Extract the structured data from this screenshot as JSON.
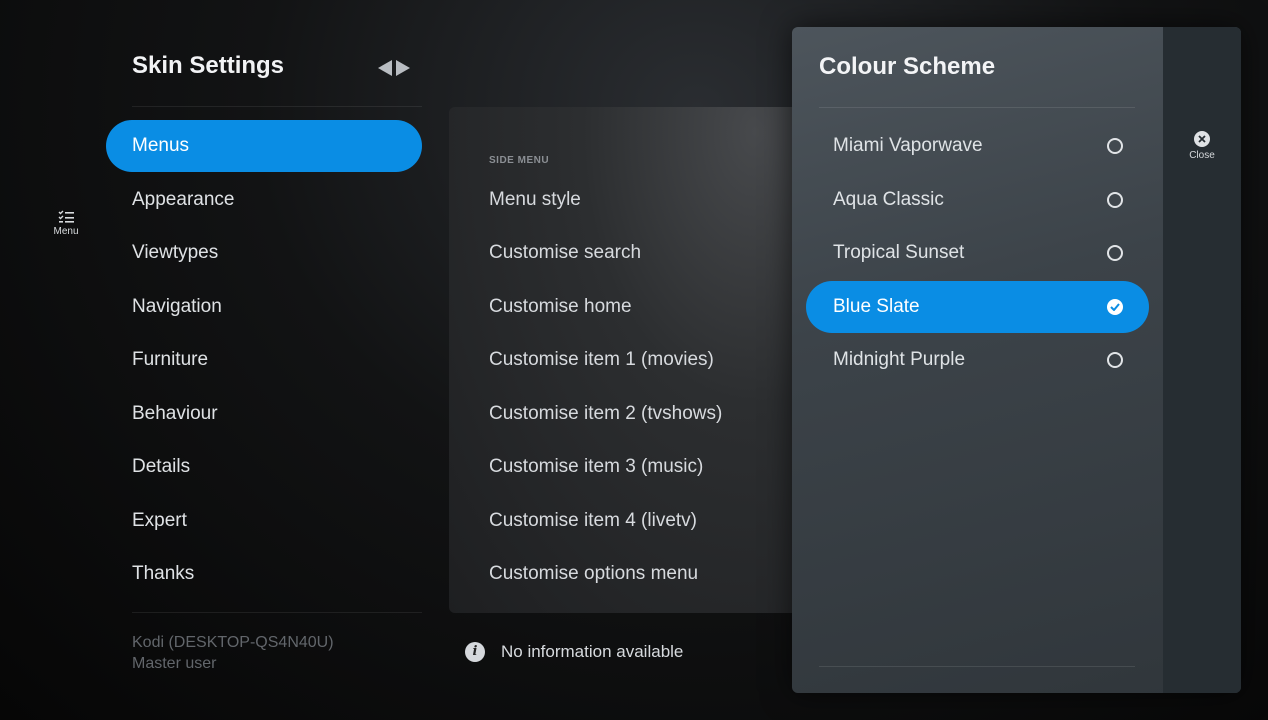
{
  "rail": {
    "menu_label": "Menu",
    "menu_icon": "checklist-icon"
  },
  "sidebar": {
    "title": "Skin Settings",
    "items": [
      {
        "label": "Menus",
        "active": true
      },
      {
        "label": "Appearance"
      },
      {
        "label": "Viewtypes"
      },
      {
        "label": "Navigation"
      },
      {
        "label": "Furniture"
      },
      {
        "label": "Behaviour"
      },
      {
        "label": "Details"
      },
      {
        "label": "Expert"
      },
      {
        "label": "Thanks"
      }
    ],
    "footer": {
      "line1": "Kodi (DESKTOP-QS4N40U)",
      "line2": "Master user"
    }
  },
  "panel": {
    "section_header": "SIDE MENU",
    "items": [
      "Menu style",
      "Customise search",
      "Customise home",
      "Customise item 1 (movies)",
      "Customise item 2 (tvshows)",
      "Customise item 3 (music)",
      "Customise item 4 (livetv)",
      "Customise options menu"
    ]
  },
  "info": {
    "icon": "info-icon",
    "text": "No information available"
  },
  "dialog": {
    "title": "Colour Scheme",
    "options": [
      {
        "label": "Miami Vaporwave",
        "selected": false
      },
      {
        "label": "Aqua Classic",
        "selected": false
      },
      {
        "label": "Tropical Sunset",
        "selected": false
      },
      {
        "label": "Blue Slate",
        "selected": true
      },
      {
        "label": "Midnight Purple",
        "selected": false
      }
    ],
    "close_label": "Close"
  },
  "colors": {
    "accent": "#0a8de4"
  }
}
